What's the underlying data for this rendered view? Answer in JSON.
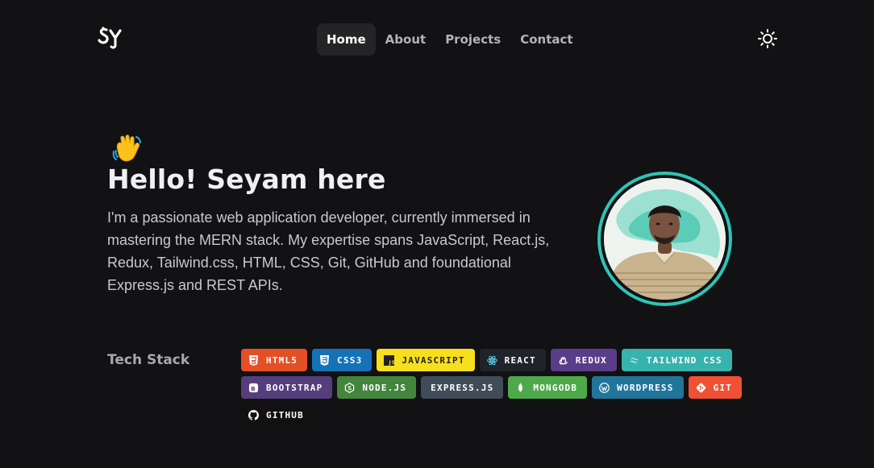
{
  "nav": {
    "logo_alt": "SY",
    "items": [
      {
        "label": "Home",
        "active": true
      },
      {
        "label": "About",
        "active": false
      },
      {
        "label": "Projects",
        "active": false
      },
      {
        "label": "Contact",
        "active": false
      }
    ],
    "theme_icon": "sun-icon"
  },
  "hero": {
    "wave_emoji": "👋",
    "title": "Hello! Seyam here",
    "description": "I'm a passionate web application developer, currently immersed in mastering the MERN stack. My expertise spans JavaScript, React.js, Redux, Tailwind.css, HTML, CSS, Git, GitHub and foundational Express.js and REST APIs."
  },
  "tech": {
    "label": "Tech Stack",
    "badges": [
      {
        "label": "HTML5",
        "color": "#e34f26",
        "text_color": "#ffffff",
        "icon": "html5-icon"
      },
      {
        "label": "CSS3",
        "color": "#1572b6",
        "text_color": "#ffffff",
        "icon": "css3-icon"
      },
      {
        "label": "JAVASCRIPT",
        "color": "#f7df1e",
        "text_color": "#222222",
        "icon": "javascript-icon"
      },
      {
        "label": "REACT",
        "color": "#20232a",
        "text_color": "#ffffff",
        "icon": "react-icon"
      },
      {
        "label": "REDUX",
        "color": "#593d88",
        "text_color": "#ffffff",
        "icon": "redux-icon"
      },
      {
        "label": "TAILWIND CSS",
        "color": "#38b2ac",
        "text_color": "#ffffff",
        "icon": "tailwind-icon"
      },
      {
        "label": "BOOTSTRAP",
        "color": "#563d7c",
        "text_color": "#ffffff",
        "icon": "bootstrap-icon"
      },
      {
        "label": "NODE.JS",
        "color": "#43853d",
        "text_color": "#ffffff",
        "icon": "nodejs-icon"
      },
      {
        "label": "EXPRESS.JS",
        "color": "#404d59",
        "text_color": "#ffffff",
        "icon": ""
      },
      {
        "label": "MONGODB",
        "color": "#4ea94b",
        "text_color": "#ffffff",
        "icon": "mongodb-icon"
      },
      {
        "label": "WORDPRESS",
        "color": "#21759b",
        "text_color": "#ffffff",
        "icon": "wordpress-icon"
      },
      {
        "label": "GIT",
        "color": "#f05033",
        "text_color": "#ffffff",
        "icon": "git-icon"
      },
      {
        "label": "GITHUB",
        "color": "#121011",
        "text_color": "#ffffff",
        "icon": "github-icon"
      }
    ]
  },
  "colors": {
    "background": "#121113",
    "accent_ring": "#2ec4b6",
    "nav_active_bg": "#242326"
  }
}
